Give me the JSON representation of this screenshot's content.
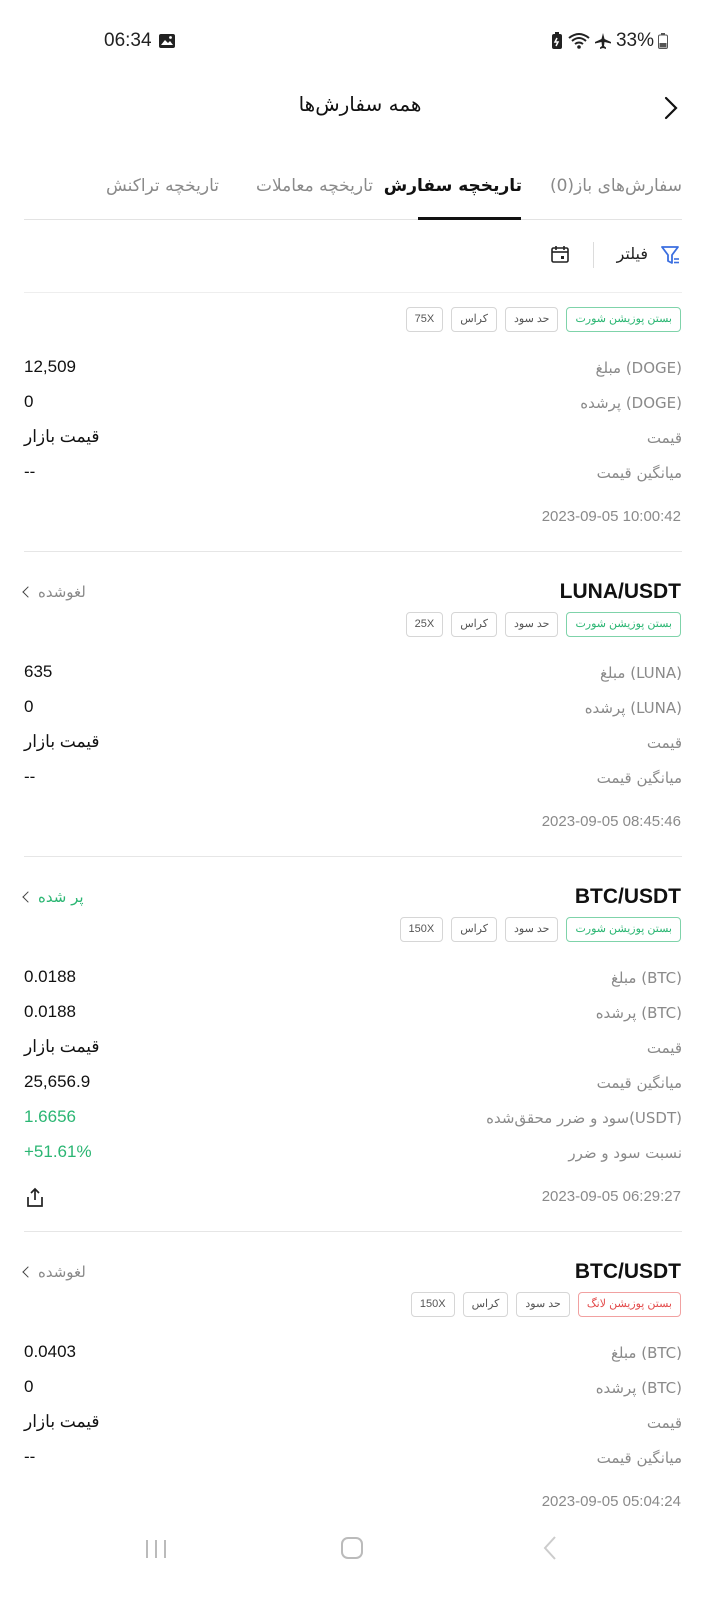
{
  "status_bar": {
    "time": "06:34",
    "battery": "33%",
    "icons": [
      "photo-icon",
      "battery-saver-icon",
      "wifi-icon",
      "airplane-icon",
      "battery-icon"
    ]
  },
  "header": {
    "title": "همه سفارش‌ها",
    "back_icon": "chevron-right-icon"
  },
  "tabs": [
    {
      "label": "سفارش‌های باز(0)",
      "active": false
    },
    {
      "label": "تاریخچه سفارش",
      "active": true
    },
    {
      "label": "تاریخچه معاملات",
      "active": false
    },
    {
      "label": "تاریخچه تراکنش",
      "active": false
    }
  ],
  "toolbar": {
    "filter_label": "فیلتر",
    "filter_icon": "filter-icon",
    "calendar_icon": "calendar-icon"
  },
  "orders": [
    {
      "pair": "",
      "status": "",
      "tags": [
        "بستن پوزیشن شورت",
        "حد سود",
        "کراس",
        "75X"
      ],
      "rows": [
        {
          "label": "مبلغ (DOGE)",
          "value": "12,509"
        },
        {
          "label": "پرشده (DOGE)",
          "value": "0"
        },
        {
          "label": "قیمت",
          "value": "قیمت بازار"
        },
        {
          "label": "میانگین قیمت",
          "value": "--"
        }
      ],
      "timestamp": "2023-09-05 10:00:42"
    },
    {
      "pair": "LUNA/USDT",
      "status": "لغوشده",
      "tags": [
        "بستن پوزیشن شورت",
        "حد سود",
        "کراس",
        "25X"
      ],
      "rows": [
        {
          "label": "مبلغ (LUNA)",
          "value": "635"
        },
        {
          "label": "پرشده (LUNA)",
          "value": "0"
        },
        {
          "label": "قیمت",
          "value": "قیمت بازار"
        },
        {
          "label": "میانگین قیمت",
          "value": "--"
        }
      ],
      "timestamp": "2023-09-05 08:45:46"
    },
    {
      "pair": "BTC/USDT",
      "status": "پر شده",
      "tags": [
        "بستن پوزیشن شورت",
        "حد سود",
        "کراس",
        "150X"
      ],
      "rows": [
        {
          "label": "مبلغ (BTC)",
          "value": "0.0188"
        },
        {
          "label": "پرشده (BTC)",
          "value": "0.0188"
        },
        {
          "label": "قیمت",
          "value": "قیمت بازار"
        },
        {
          "label": "میانگین قیمت",
          "value": "25,656.9"
        },
        {
          "label": "سود و ضرر محقق‌شده(USDT)",
          "value": "1.6656"
        },
        {
          "label": "نسبت سود و ضرر",
          "value": "+51.61%"
        }
      ],
      "timestamp": "2023-09-05 06:29:27"
    },
    {
      "pair": "BTC/USDT",
      "status": "لغوشده",
      "tags": [
        "بستن پوزیشن لانگ",
        "حد سود",
        "کراس",
        "150X"
      ],
      "rows": [
        {
          "label": "مبلغ (BTC)",
          "value": "0.0403"
        },
        {
          "label": "پرشده (BTC)",
          "value": "0"
        },
        {
          "label": "قیمت",
          "value": "قیمت بازار"
        },
        {
          "label": "میانگین قیمت",
          "value": "--"
        }
      ],
      "timestamp": "2023-09-05 05:04:24"
    }
  ],
  "colors": {
    "profit_green": "#2bb673",
    "loss_red": "#e34d4d",
    "muted_text": "#8a8a8a"
  },
  "nav_bar": {
    "icons": [
      "recents-icon",
      "home-icon",
      "back-icon"
    ]
  }
}
